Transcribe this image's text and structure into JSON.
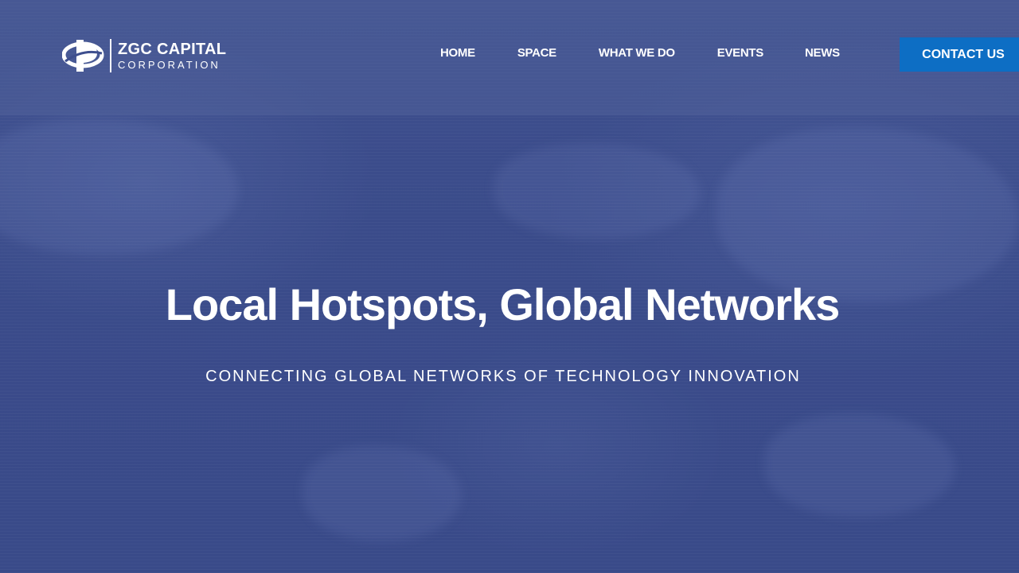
{
  "header": {
    "logo": {
      "name": "ZGC CAPITAL",
      "subtitle": "CORPORATION",
      "icon": "zgc-logo-icon"
    },
    "nav": [
      {
        "label": "HOME"
      },
      {
        "label": "SPACE"
      },
      {
        "label": "WHAT WE DO"
      },
      {
        "label": "EVENTS"
      },
      {
        "label": "NEWS"
      }
    ],
    "contact_button": "CONTACT US"
  },
  "hero": {
    "title": "Local Hotspots, Global Networks",
    "subtitle": "CONNECTING GLOBAL NETWORKS OF TECHNOLOGY INNOVATION"
  },
  "colors": {
    "background": "#3a4b8a",
    "accent": "#0d6ec4",
    "text": "#ffffff"
  }
}
